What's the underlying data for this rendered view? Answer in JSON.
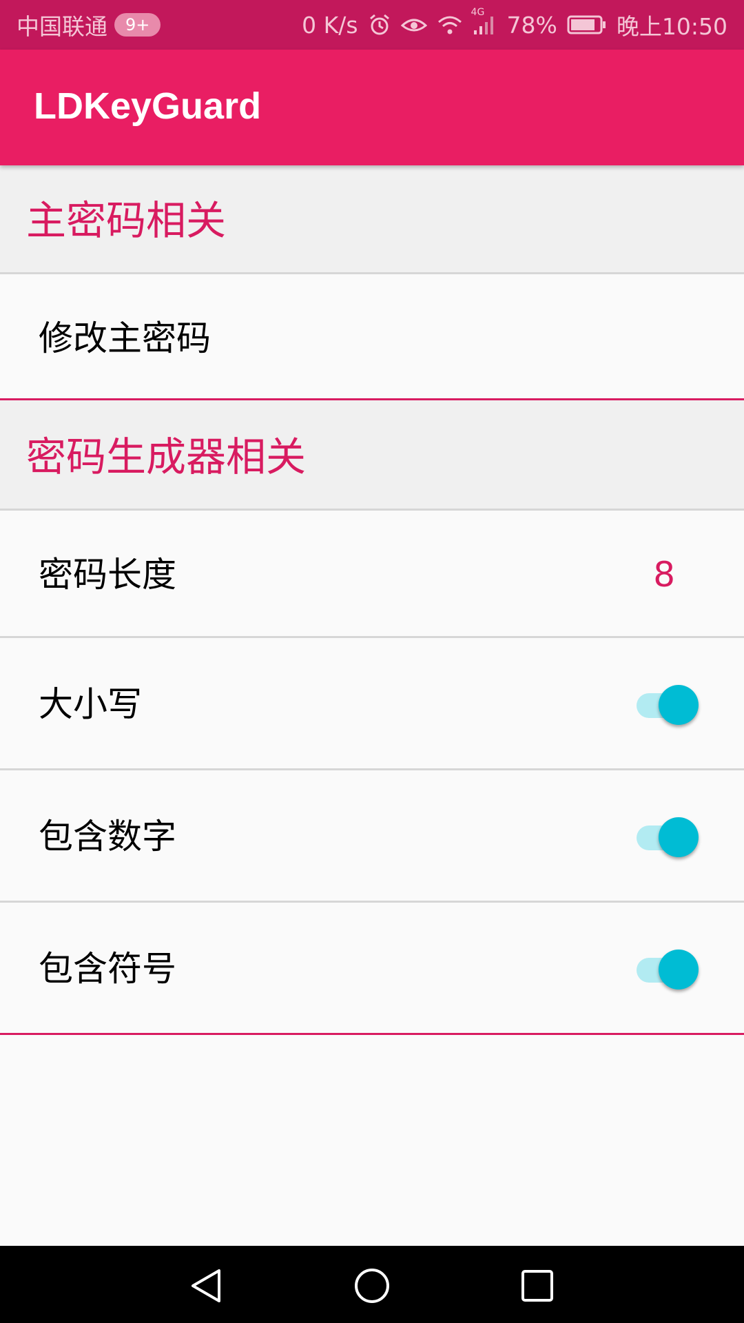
{
  "status_bar": {
    "carrier": "中国联通",
    "notification_badge": "9+",
    "net_speed": "0 K/s",
    "network_type": "4G",
    "battery_percent": "78%",
    "time": "晚上10:50",
    "icons": [
      "alarm-icon",
      "eye-icon",
      "wifi-icon",
      "signal-icon",
      "battery-icon"
    ]
  },
  "app_bar": {
    "title": "LDKeyGuard"
  },
  "sections": [
    {
      "title": "主密码相关",
      "items": [
        {
          "label": "修改主密码"
        }
      ]
    },
    {
      "title": "密码生成器相关",
      "items": [
        {
          "label": "密码长度",
          "value": "8"
        },
        {
          "label": "大小写",
          "switch_on": true
        },
        {
          "label": "包含数字",
          "switch_on": true
        },
        {
          "label": "包含符号",
          "switch_on": true
        }
      ]
    }
  ],
  "colors": {
    "primary": "#e91e63",
    "primary_dark": "#c2185b",
    "accent": "#d81b60",
    "switch_thumb": "#00bcd4",
    "switch_track": "#b2ebf2"
  },
  "nav_bar": {
    "icons": [
      "back-icon",
      "home-icon",
      "recents-icon"
    ]
  }
}
